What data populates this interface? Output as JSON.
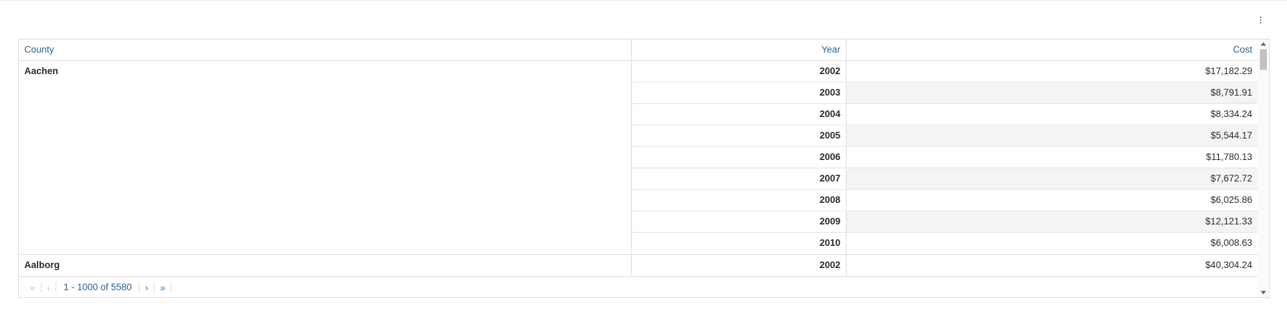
{
  "menu_icon": "kebab-vertical-icon",
  "columns": {
    "county": "County",
    "year": "Year",
    "cost": "Cost"
  },
  "groups": [
    {
      "county": "Aachen",
      "rows": [
        {
          "year": "2002",
          "cost": "$17,182.29"
        },
        {
          "year": "2003",
          "cost": "$8,791.91"
        },
        {
          "year": "2004",
          "cost": "$8,334.24"
        },
        {
          "year": "2005",
          "cost": "$5,544.17"
        },
        {
          "year": "2006",
          "cost": "$11,780.13"
        },
        {
          "year": "2007",
          "cost": "$7,672.72"
        },
        {
          "year": "2008",
          "cost": "$6,025.86"
        },
        {
          "year": "2009",
          "cost": "$12,121.33"
        },
        {
          "year": "2010",
          "cost": "$6,008.63"
        }
      ]
    },
    {
      "county": "Aalborg",
      "rows": [
        {
          "year": "2002",
          "cost": "$40,304.24"
        }
      ]
    }
  ],
  "pagination": {
    "first": "«",
    "prev": "‹",
    "label": "1 - 1000 of 5580",
    "next": "›",
    "last": "»"
  },
  "colors": {
    "header_text": "#2e5f92",
    "pager_icon": "#2e7bbf",
    "stripe": "#f4f4f5"
  }
}
